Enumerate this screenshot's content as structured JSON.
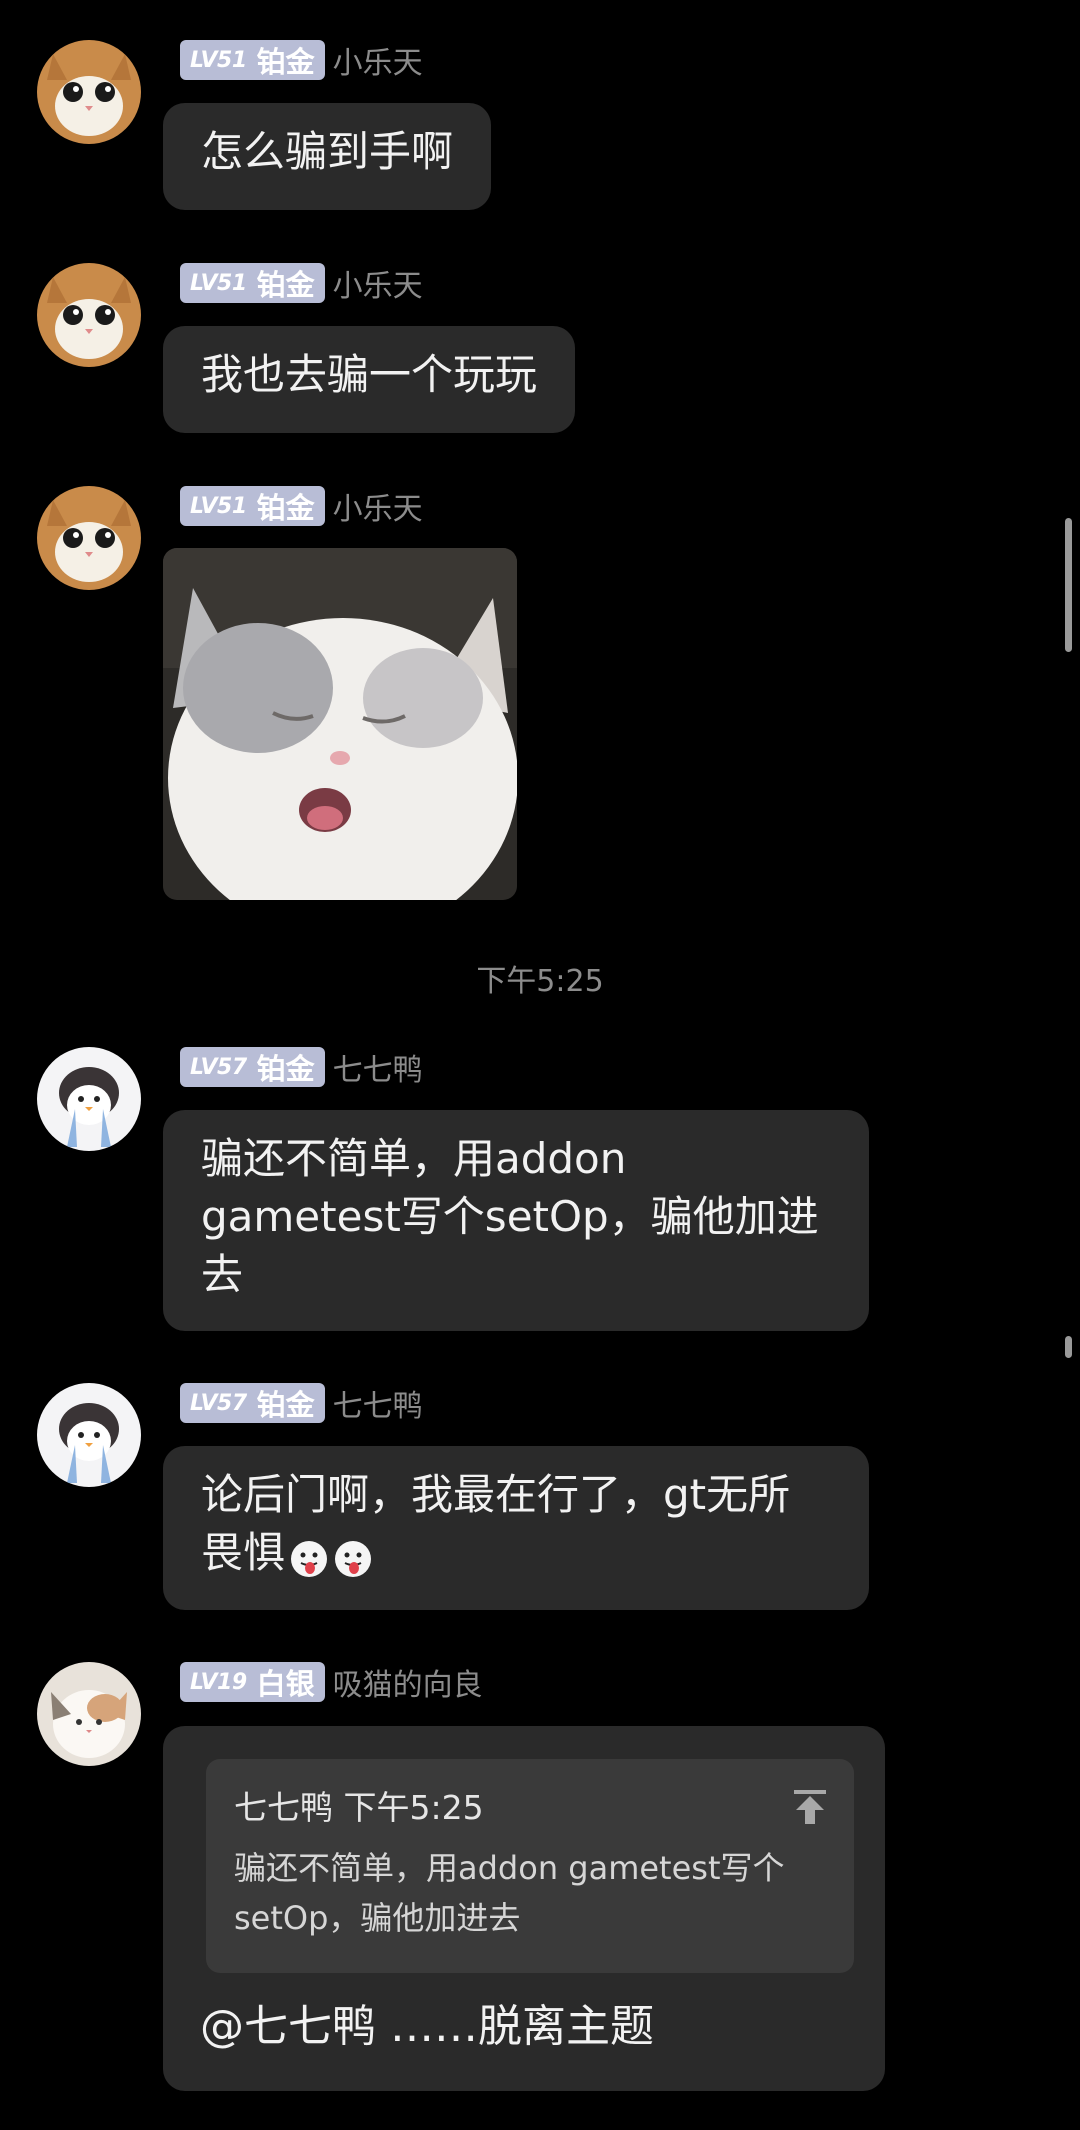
{
  "messages": [
    {
      "level": "LV51",
      "rank": "铂金",
      "nickname": "小乐天",
      "text": "怎么骗到手啊"
    },
    {
      "level": "LV51",
      "rank": "铂金",
      "nickname": "小乐天",
      "text": "我也去骗一个玩玩"
    },
    {
      "level": "LV51",
      "rank": "铂金",
      "nickname": "小乐天",
      "image": "white-cat-yawn-photo"
    },
    {
      "level": "LV57",
      "rank": "铂金",
      "nickname": "七七鸭",
      "text_lines": [
        "骗还不简单，用addon",
        "gametest写个setOp，骗他加进",
        "去"
      ]
    },
    {
      "level": "LV57",
      "rank": "铂金",
      "nickname": "七七鸭",
      "text_lines": [
        "论后门啊，我最在行了，gt无所",
        "畏惧"
      ],
      "emojis": [
        "tongue-out-emoji",
        "tongue-out-emoji"
      ]
    },
    {
      "level": "LV19",
      "rank": "白银",
      "nickname": "吸猫的向良",
      "quote": {
        "author": "七七鸭",
        "time": "下午5:25",
        "text_lines": [
          "骗还不简单，用addon gametest写个",
          "setOp，骗他加进去"
        ]
      },
      "text": "@七七鸭 ……脱离主题"
    }
  ],
  "timestamp": "下午5:25",
  "colors": {
    "background": "#000000",
    "bubble": "#2a2a2a",
    "badge": "#b8bdd6",
    "nickname": "#8c8c8c",
    "quote": "#3a3a3a"
  }
}
